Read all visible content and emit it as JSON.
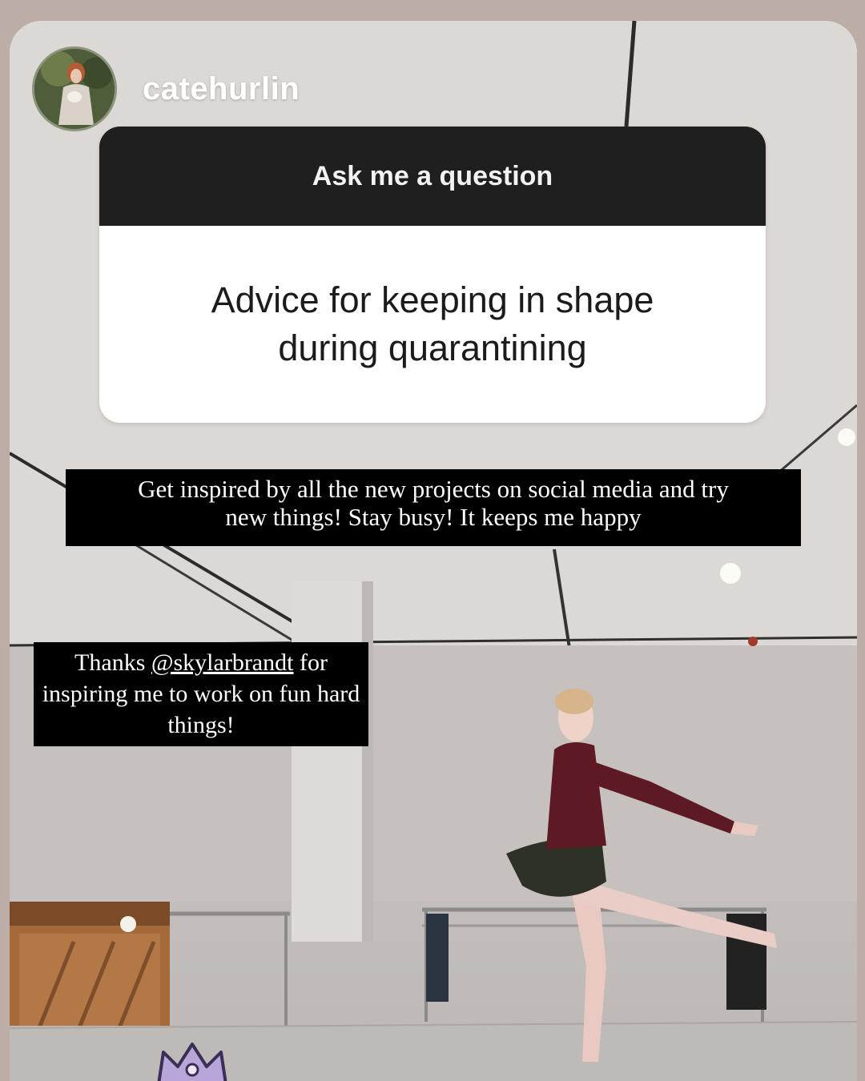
{
  "story": {
    "username": "catehurlin"
  },
  "question_sticker": {
    "prompt": "Ask me a question",
    "question": "Advice for keeping in shape during quarantining"
  },
  "captions": [
    {
      "line1": "Get inspired by all the new projects on social media and try",
      "line2": "new things! Stay busy! It keeps me happy"
    },
    {
      "before": "Thanks ",
      "mention": "@skylarbrandt",
      "after": " for inspiring me to work on fun hard things!"
    }
  ],
  "colors": {
    "outer_background": "#bcaea6",
    "sticker_header": "#1f1f1f",
    "sticker_body": "#ffffff",
    "caption_background": "#000000",
    "leotard": "#5e1a24"
  }
}
